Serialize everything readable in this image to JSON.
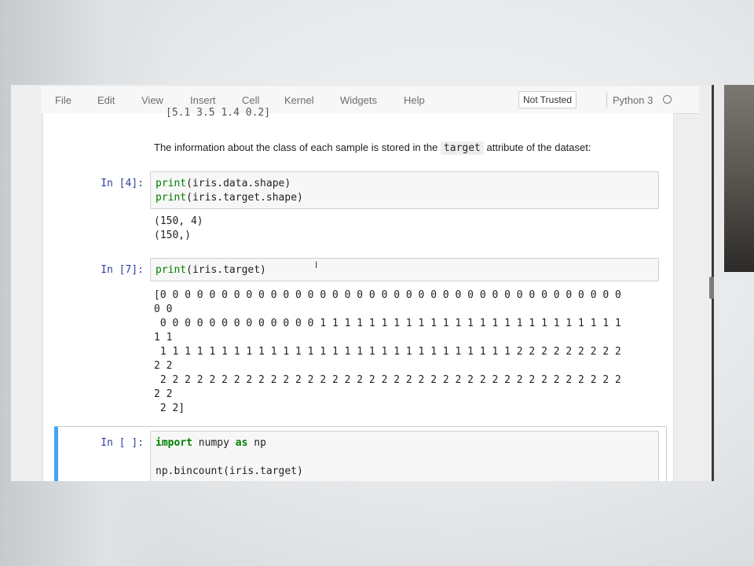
{
  "menu": {
    "items": [
      "File",
      "Edit",
      "View",
      "Insert",
      "Cell",
      "Kernel",
      "Widgets",
      "Help"
    ],
    "trust_status": "Not Trusted",
    "kernel_name": "Python 3"
  },
  "cells": {
    "partial_output": "[5.1 3.5 1.4 0.2]",
    "markdown": {
      "before": "The information about the class of each sample is stored in the ",
      "code": "target",
      "after": " attribute of the dataset:"
    },
    "cell4": {
      "prompt": "In [4]:",
      "lines": [
        "print(iris.data.shape)",
        "print(iris.target.shape)"
      ],
      "output": [
        "(150, 4)",
        "(150,)"
      ]
    },
    "cell7": {
      "prompt": "In [7]:",
      "line": "print(iris.target)",
      "output": [
        "[0 0 0 0 0 0 0 0 0 0 0 0 0 0 0 0 0 0 0 0 0 0 0 0 0 0 0 0 0 0 0 0 0 0 0 0 0 0",
        "0 0",
        " 0 0 0 0 0 0 0 0 0 0 0 0 0 1 1 1 1 1 1 1 1 1 1 1 1 1 1 1 1 1 1 1 1 1 1 1 1 1",
        "1 1",
        " 1 1 1 1 1 1 1 1 1 1 1 1 1 1 1 1 1 1 1 1 1 1 1 1 1 1 1 1 1 2 2 2 2 2 2 2 2 2",
        "2 2",
        " 2 2 2 2 2 2 2 2 2 2 2 2 2 2 2 2 2 2 2 2 2 2 2 2 2 2 2 2 2 2 2 2 2 2 2 2 2 2",
        "2 2",
        " 2 2]"
      ]
    },
    "cell_new": {
      "prompt": "In [ ]:",
      "line1_kw1": "import",
      "line1_mid": " numpy ",
      "line1_kw2": "as",
      "line1_end": " np",
      "line2": "np.bincount(iris.target)"
    }
  },
  "icons": [
    "kernel-idle-icon",
    "text-cursor-icon"
  ]
}
